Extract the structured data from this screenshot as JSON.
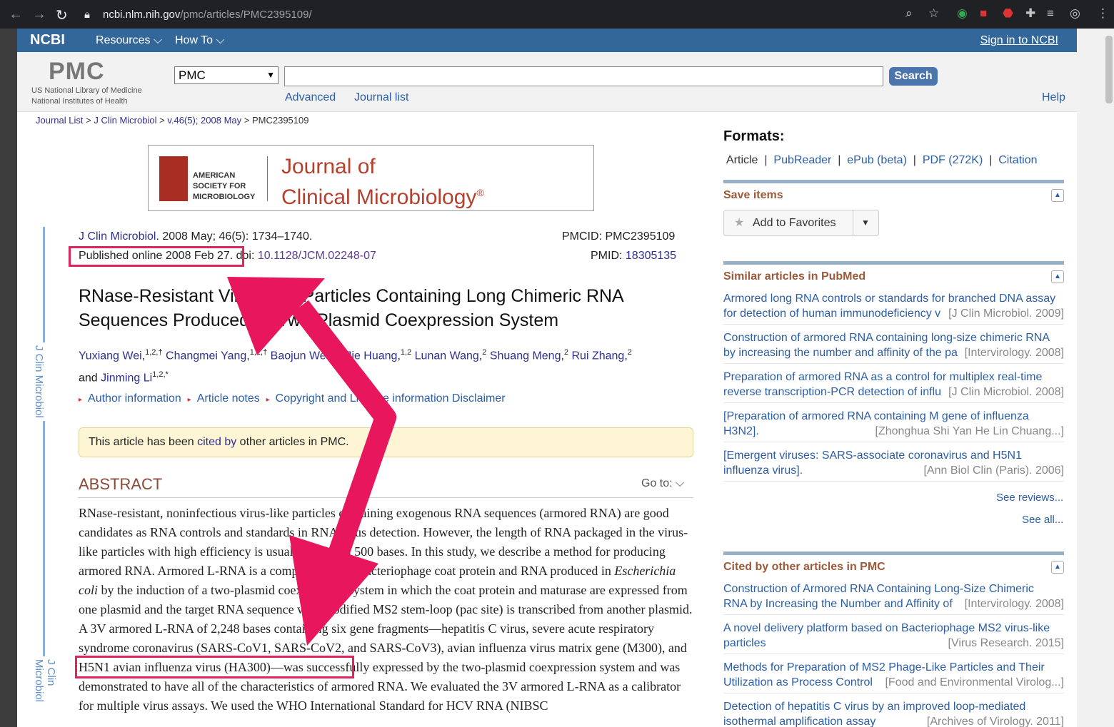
{
  "browser": {
    "url_host": "ncbi.nlm.nih.gov",
    "url_path": "/pmc/articles/PMC2395109/"
  },
  "ncbi_bar": {
    "logo": "NCBI",
    "resources": "Resources",
    "howto": "How To",
    "signin": "Sign in to NCBI"
  },
  "header": {
    "logo": "PMC",
    "nlm_line1": "US National Library of Medicine",
    "nlm_line2": "National Institutes of Health",
    "db": "PMC",
    "search": "Search",
    "advanced": "Advanced",
    "journal_list": "Journal list",
    "help": "Help"
  },
  "breadcrumb": {
    "journal_list": "Journal List",
    "journal": "J Clin Microbiol",
    "volume": "v.46(5); 2008 May",
    "current": "PMC2395109"
  },
  "banner": {
    "society1": "AMERICAN",
    "society2": "SOCIETY FOR",
    "society3": "MICROBIOLOGY",
    "jname1": "Journal of",
    "jname2": "Clinical Microbiology",
    "reg": "®"
  },
  "side_label": "J Clin Microbiol",
  "citation": {
    "journal": "J Clin Microbiol",
    "rest": ". 2008 May; 46(5): 1734–1740.",
    "published": "Published online 2008 Feb 27.",
    "doi_label": " doi: ",
    "doi": "10.1128/JCM.02248-07",
    "pmcid": "PMCID: PMC2395109",
    "pmid_label": "PMID: ",
    "pmid": "18305135"
  },
  "article": {
    "title": "RNase-Resistant Virus-Like Particles Containing Long Chimeric RNA Sequences Produced by Two-Plasmid Coexpression System"
  },
  "authors": [
    {
      "name": "Yuxiang Wei",
      "sup": "1,2,†"
    },
    {
      "name": "Changmei Yang",
      "sup": "1,2,†"
    },
    {
      "name": "Baojun Wei",
      "sup": "1,2"
    },
    {
      "name": "Jie Huang",
      "sup": "1,2"
    },
    {
      "name": "Lunan Wang",
      "sup": "2"
    },
    {
      "name": "Shuang Meng",
      "sup": "2"
    },
    {
      "name": "Rui Zhang",
      "sup": "2"
    },
    {
      "name": "Jinming Li",
      "sup": "1,2,*"
    }
  ],
  "authors_and": "and ",
  "links": {
    "author_info": "Author information",
    "article_notes": "Article notes",
    "copyright": "Copyright and License information",
    "disclaimer": "Disclaimer"
  },
  "cited_box": {
    "pre": "This article has been ",
    "link": "cited by",
    "post": " other articles in PMC."
  },
  "abstract": {
    "heading": "ABSTRACT",
    "goto": "Go to:",
    "p1": "RNase-resistant, noninfectious virus-like particles containing exogenous RNA sequences (armored RNA) are good candidates as RNA controls and standards in RNA virus detection. However, the length of RNA packaged in the virus-like particles with high efficiency is usually less than 500 bases. In this study, we describe a method for producing armored RNA. Armored L-RNA is a complex of MS2 bacteriophage coat protein and RNA produced in ",
    "italic": "Escherichia coli",
    "p2": " by the induction of a two-plasmid coexpression system in which the coat protein and maturase are expressed from one plasmid and the target RNA sequence with modified MS2 stem-loop (pac site) is transcribed from another plasmid. A 3V armored L-RNA of 2,248 bases containing six gene fragments—hepatitis C virus, severe acute respiratory syndrome coronavirus ",
    "sars": "(SARS-CoV1, SARS-CoV2, and SARS-CoV3),",
    "p3": " avian influenza virus matrix gene (M300), and H5N1 avian influenza virus (HA300)—was successfully expressed by the two-plasmid coexpression system and was demonstrated to have all of the characteristics of armored RNA. We evaluated the 3V armored L-RNA as a calibrator for multiple virus assays. We used the WHO International Standard for HCV RNA (NIBSC"
  },
  "formats": {
    "heading": "Formats:",
    "article": "Article",
    "pubreader": "PubReader",
    "epub": "ePub (beta)",
    "pdf": "PDF (272K)",
    "citation": "Citation"
  },
  "save": {
    "heading": "Save items",
    "add": "Add to Favorites"
  },
  "similar": {
    "heading": "Similar articles in PubMed",
    "items": [
      {
        "t1": "Armored long RNA controls or standards for branched DNA assay",
        "t2": "for detection of human immunodeficiency v",
        "src": "[J Clin Microbiol. 2009]"
      },
      {
        "t1": "Construction of armored RNA containing long-size chimeric RNA",
        "t2": "by increasing the number and affinity of the pa",
        "src": "[Intervirology. 2008]"
      },
      {
        "t1": "Preparation of armored RNA as a control for multiplex real-time",
        "t2": "reverse transcription-PCR detection of influ",
        "src": "[J Clin Microbiol. 2008]"
      },
      {
        "t1": "[Preparation of armored RNA containing M gene of influenza",
        "t2": "H3N2].",
        "src": "[Zhonghua Shi Yan He Lin Chuang...]"
      },
      {
        "t1": "[Emergent viruses: SARS-associate coronavirus and H5N1",
        "t2": "influenza virus].",
        "src": "[Ann Biol Clin (Paris). 2006]"
      }
    ],
    "see_reviews": "See reviews...",
    "see_all": "See all..."
  },
  "cited_pmc": {
    "heading": "Cited by other articles in PMC",
    "items": [
      {
        "t1": "Construction of Armored RNA Containing Long-Size Chimeric",
        "t2": "RNA by Increasing the Number and Affinity of",
        "src": "[Intervirology. 2008]"
      },
      {
        "t1": "A novel delivery platform based on Bacteriophage MS2 virus-like",
        "t2": "particles",
        "src": "[Virus Research. 2015]"
      },
      {
        "t1": "Methods for Preparation of MS2 Phage-Like Particles and Their",
        "t2": "Utilization as Process Control",
        "src": "[Food and Environmental Virolog...]"
      },
      {
        "t1": "Detection of hepatitis C virus by an improved loop-mediated",
        "t2": "isothermal amplification assay",
        "src": "[Archives of Virology. 2011]"
      }
    ]
  },
  "colors": {
    "ncbi_blue": "#336699",
    "annotation": "#e0245e",
    "abstract_heading": "#8a4a35"
  }
}
